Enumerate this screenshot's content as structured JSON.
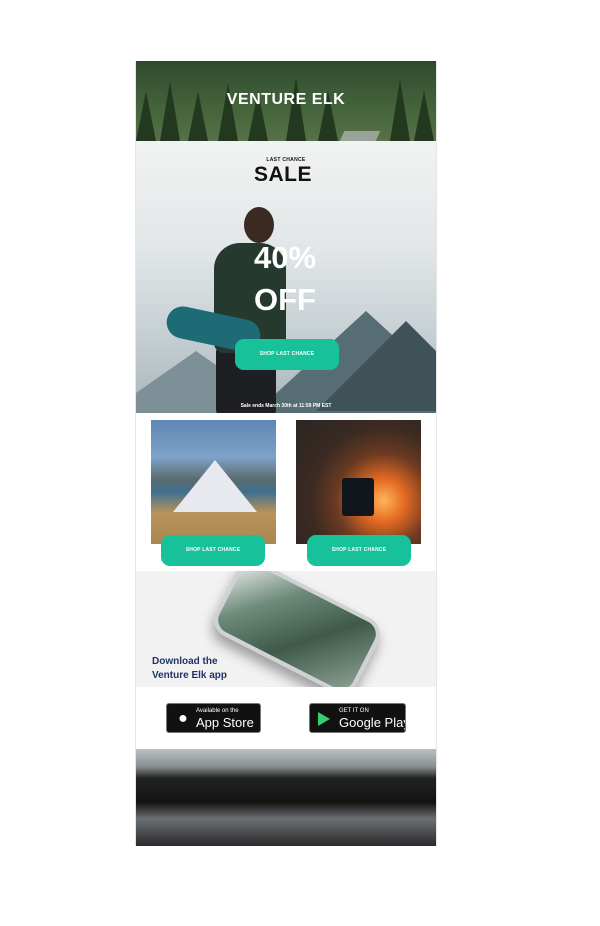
{
  "header": {
    "brand": "VENTURE ELK"
  },
  "hero": {
    "tagline": "LAST CHANCE",
    "title": "SALE",
    "discount_line1": "40%",
    "discount_line2": "OFF",
    "cta_label": "SHOP LAST CHANCE",
    "sale_ends": "Sale ends March 30th at 11:59 PM EST"
  },
  "products": [
    {
      "image": "tent-camping-photo",
      "cta_label": "SHOP LAST CHANCE"
    },
    {
      "image": "campfire-mug-photo",
      "cta_label": "SHOP LAST CHANCE"
    }
  ],
  "app_section": {
    "line1": "Download the",
    "line2": "Venture Elk app"
  },
  "stores": {
    "apple": {
      "small": "Available on the",
      "big": "App Store",
      "icon": "apple-icon"
    },
    "google": {
      "small": "GET IT ON",
      "big": "Google Play",
      "icon": "google-play-icon"
    }
  },
  "colors": {
    "accent": "#17c29a",
    "app_text": "#1f3464"
  }
}
